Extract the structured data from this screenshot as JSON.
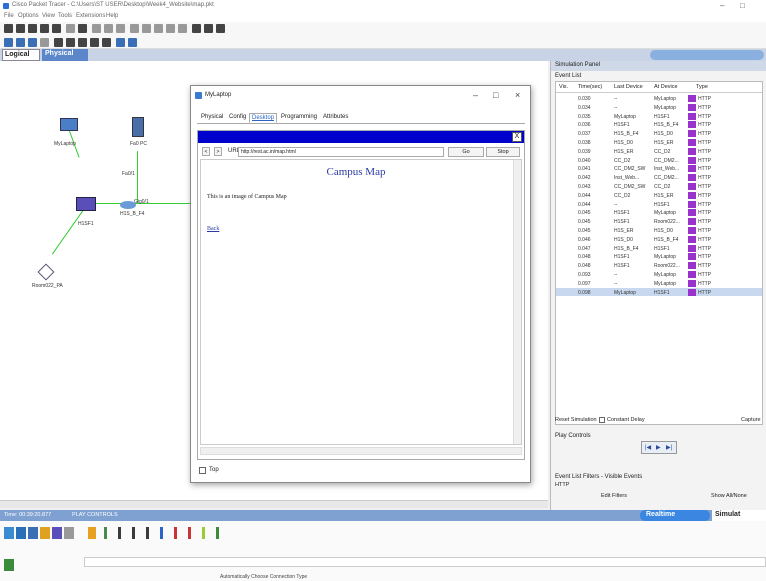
{
  "app": {
    "title": "Cisco Packet Tracer - C:\\Users\\ST USER\\Desktop\\Week4_Website\\map.pkt",
    "menu": [
      "File",
      "Options",
      "View",
      "Tools",
      "Extensions",
      "Help"
    ]
  },
  "workspace_tabs": {
    "logical": "Logical",
    "physical": "Physical"
  },
  "topology": {
    "devices": [
      {
        "label": "MyLaptop"
      },
      {
        "label": "Fa0 PC"
      },
      {
        "label": "Fa0/1"
      },
      {
        "label": "H1SF1"
      },
      {
        "label": "H1S_B_F4"
      },
      {
        "label": "Room022_PA"
      },
      {
        "label": "Gig0/1"
      }
    ]
  },
  "popup": {
    "title": "MyLaptop",
    "tabs": [
      "Physical",
      "Config",
      "Desktop",
      "Programming",
      "Attributes"
    ],
    "active_tab": "Desktop",
    "browser": {
      "close": "X",
      "url_label": "URL",
      "url": "http://rest.ac.in/map.html",
      "go": "Go",
      "stop": "Stop",
      "heading": "Campus Map",
      "body_text": "This is an image of Campus Map",
      "back_link": "Back"
    },
    "top_checkbox_label": "Top"
  },
  "simulation": {
    "panel_title": "Simulation Panel",
    "event_list_label": "Event List",
    "columns": [
      "Vis.",
      "Time(sec)",
      "Last Device",
      "At Device",
      "Type"
    ],
    "events": [
      [
        "0.030",
        "--",
        "MyLaptop",
        "HTTP"
      ],
      [
        "0.034",
        "--",
        "MyLaptop",
        "HTTP"
      ],
      [
        "0.035",
        "MyLaptop",
        "H1SF1",
        "HTTP"
      ],
      [
        "0.036",
        "H1SF1",
        "H1S_B_F4",
        "HTTP"
      ],
      [
        "0.037",
        "H1S_B_F4",
        "H1S_D0",
        "HTTP"
      ],
      [
        "0.038",
        "H1S_D0",
        "H1S_ER",
        "HTTP"
      ],
      [
        "0.039",
        "H1S_ER",
        "CC_D2",
        "HTTP"
      ],
      [
        "0.040",
        "CC_D2",
        "CC_DM2...",
        "HTTP"
      ],
      [
        "0.041",
        "CC_DM2_SW",
        "Inst_Web...",
        "HTTP"
      ],
      [
        "0.042",
        "Inst_Web...",
        "CC_DM2...",
        "HTTP"
      ],
      [
        "0.043",
        "CC_DM2_SW",
        "CC_D2",
        "HTTP"
      ],
      [
        "0.044",
        "CC_D2",
        "H1S_ER",
        "HTTP"
      ],
      [
        "0.044",
        "--",
        "H1SF1",
        "HTTP"
      ],
      [
        "0.045",
        "H1SF1",
        "MyLaptop",
        "HTTP"
      ],
      [
        "0.045",
        "H1SF1",
        "Room022...",
        "HTTP"
      ],
      [
        "0.045",
        "H1S_ER",
        "H1S_D0",
        "HTTP"
      ],
      [
        "0.046",
        "H1S_D0",
        "H1S_B_F4",
        "HTTP"
      ],
      [
        "0.047",
        "H1S_B_F4",
        "H1SF1",
        "HTTP"
      ],
      [
        "0.048",
        "H1SF1",
        "MyLaptop",
        "HTTP"
      ],
      [
        "0.048",
        "H1SF1",
        "Room022...",
        "HTTP"
      ],
      [
        "0.093",
        "--",
        "MyLaptop",
        "HTTP"
      ],
      [
        "0.097",
        "--",
        "MyLaptop",
        "HTTP"
      ],
      [
        "0.098",
        "MyLaptop",
        "H1SF1",
        "HTTP"
      ]
    ],
    "reset_label": "Reset Simulation",
    "constant_delay_label": "Constant Delay",
    "capture_label": "Capture",
    "play_controls_label": "Play Controls",
    "filters_label": "Event List Filters - Visible Events",
    "filters_value": "HTTP",
    "edit_filters": "Edit Filters",
    "show_all": "Show All/None"
  },
  "bottom": {
    "time_text": "Time: 00:39:20.877",
    "play_controls": "PLAY CONTROLS",
    "realtime": "Realtime",
    "simulation": "Simulat",
    "status": "Automatically Choose Connection Type"
  },
  "colors": {
    "accent": "#3a86e0",
    "http_event": "#9933cc",
    "browser_titlebar": "#0000cc"
  }
}
